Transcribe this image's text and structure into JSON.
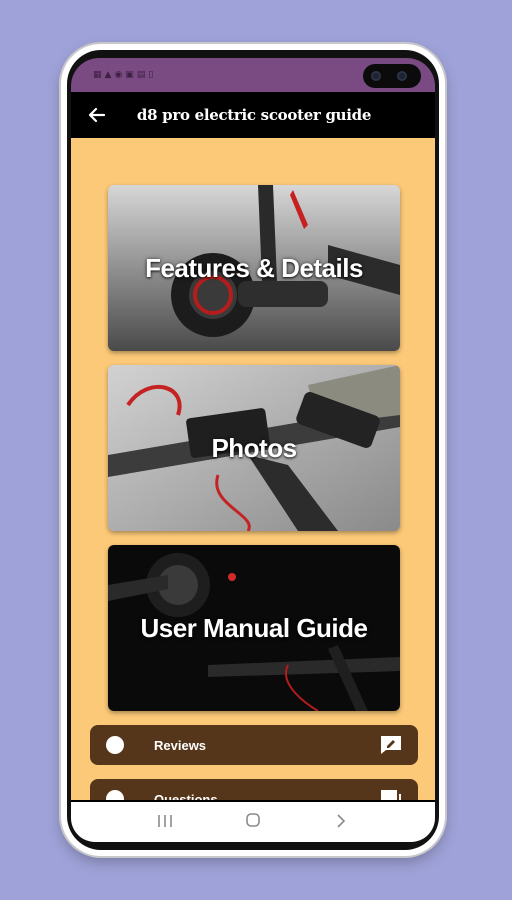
{
  "app": {
    "title": "d8 pro electric scooter guide"
  },
  "status_bar": {
    "icons": [
      "lock-icon",
      "signal-icon",
      "wifi-icon",
      "notification-icon",
      "image-icon",
      "battery-icon"
    ]
  },
  "cards": [
    {
      "title": "Features & Details"
    },
    {
      "title": "Photos"
    },
    {
      "title": "User Manual Guide"
    }
  ],
  "list": [
    {
      "label": "Reviews",
      "icon": "feedback-icon"
    },
    {
      "label": "Questions",
      "icon": "chat-icon"
    }
  ],
  "colors": {
    "background": "#9fa2d8",
    "status_bar": "#7a4a83",
    "app_bar": "#000000",
    "content_bg": "#fcc978",
    "list_item_bg": "#55361a"
  }
}
